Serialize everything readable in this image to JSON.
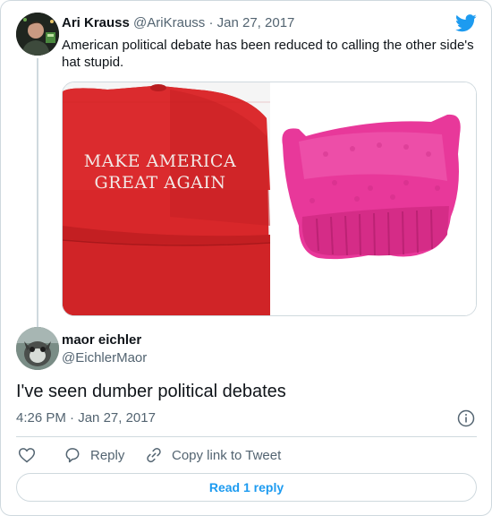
{
  "parent_tweet": {
    "author_name": "Ari Krauss",
    "author_handle": "@AriKrauss",
    "separator": "·",
    "date": "Jan 27, 2017",
    "text": "American political debate has been reduced to calling the other side's hat stupid.",
    "media": {
      "left_image": {
        "caption_line1": "MAKE AMERICA",
        "caption_line2": "GREAT AGAIN"
      },
      "right_image": {}
    }
  },
  "reply_tweet": {
    "author_name": "maor eichler",
    "author_handle": "@EichlerMaor",
    "text": "I've seen dumber political debates",
    "time": "4:26 PM",
    "separator": "·",
    "date": "Jan 27, 2017"
  },
  "actions": {
    "reply_label": "Reply",
    "copy_label": "Copy link to Tweet"
  },
  "read_replies_label": "Read 1 reply",
  "icons": [
    "twitter-bird-icon",
    "heart-icon",
    "reply-bubble-icon",
    "link-icon",
    "info-icon"
  ],
  "colors": {
    "brand_blue": "#1d9bf0",
    "text_primary": "#0f1419",
    "text_muted": "#536471",
    "border": "#cfd9de",
    "maga_red": "#d8272a",
    "pussyhat_pink": "#e8389a"
  }
}
